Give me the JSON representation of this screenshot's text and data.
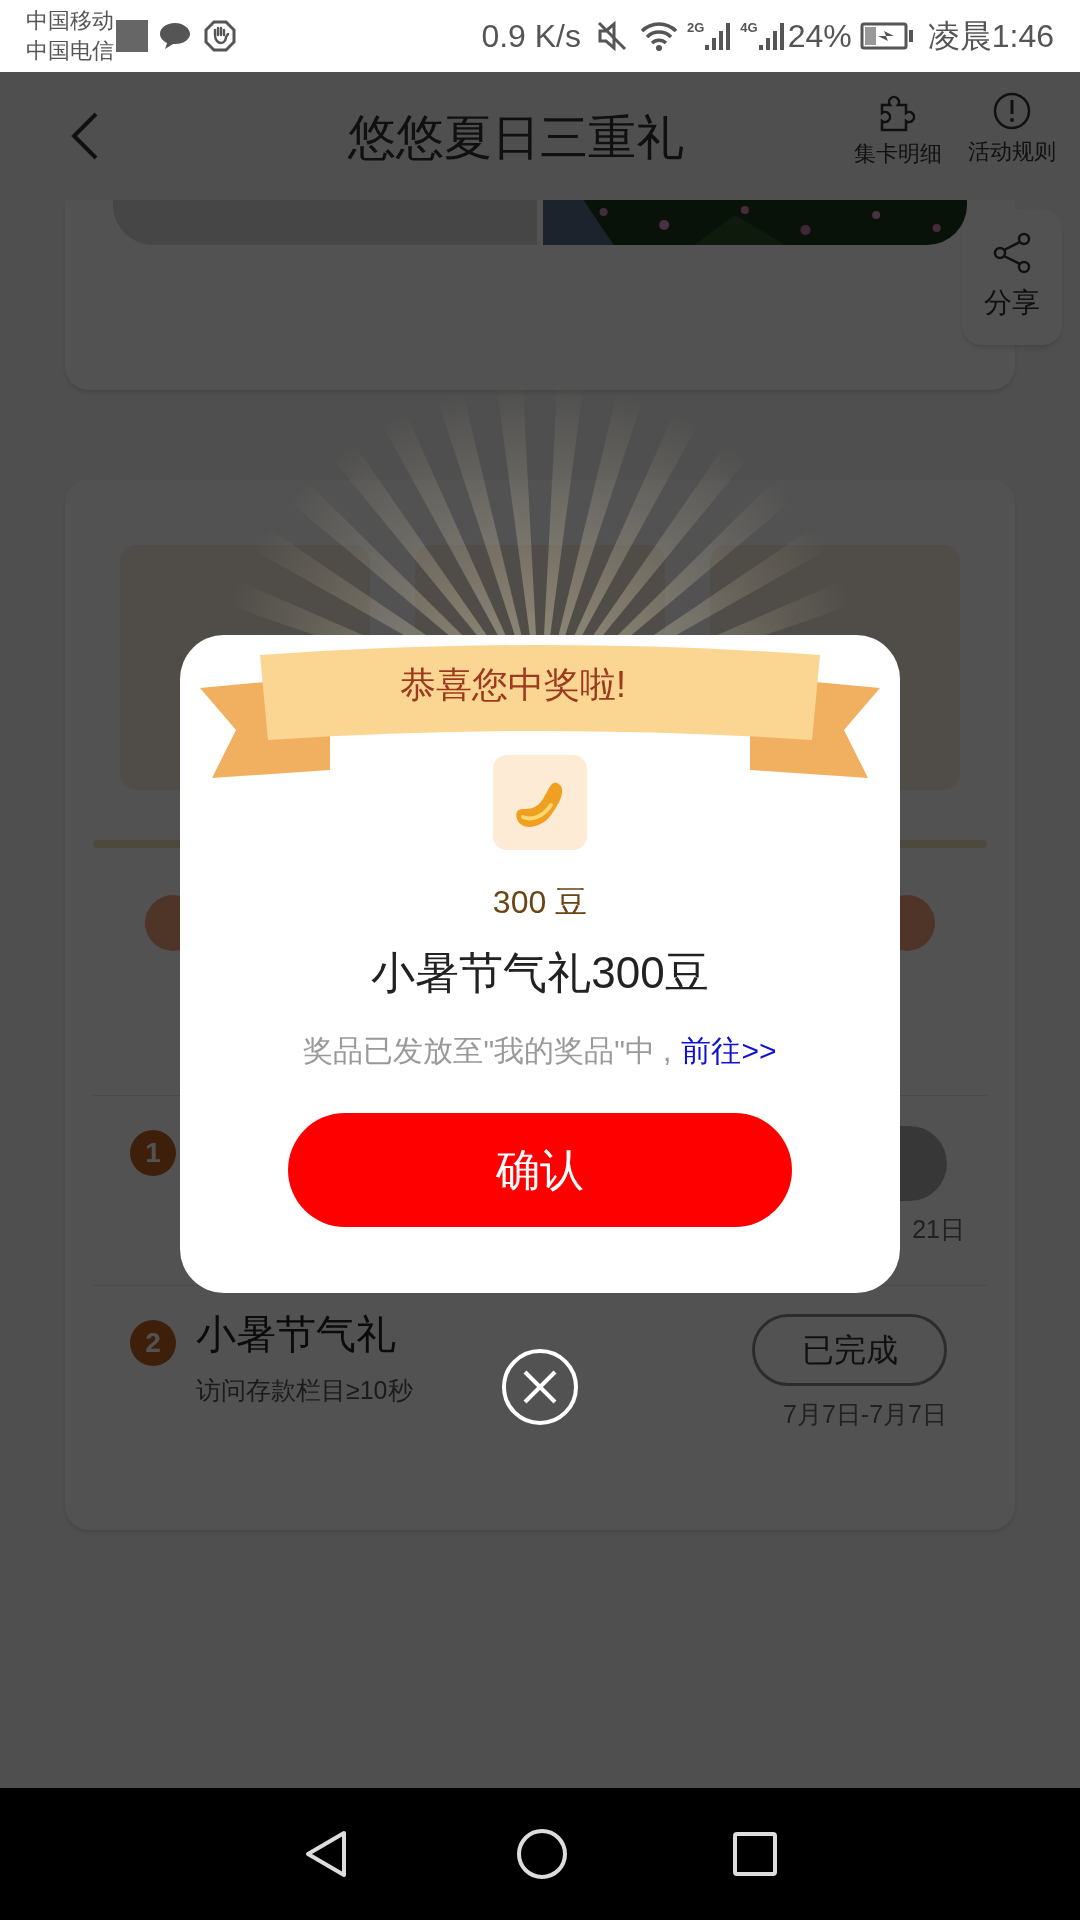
{
  "status_bar": {
    "carriers": [
      "中国移动",
      "中国电信"
    ],
    "net_speed": "0.9 K/s",
    "networks": [
      {
        "label": "2G"
      },
      {
        "label": "4G"
      }
    ],
    "battery": "24%",
    "time": "凌晨1:46"
  },
  "header": {
    "title": "悠悠夏日三重礼",
    "actions": [
      {
        "kind": "puzzle",
        "label": "集卡明细"
      },
      {
        "kind": "info",
        "label": "活动规则"
      }
    ],
    "share": "分享"
  },
  "tasks": [
    {
      "number": "1",
      "date": "21日"
    },
    {
      "number": "2",
      "title": "小暑节气礼",
      "description": "访问存款栏目≥10秒",
      "button": "已完成",
      "date": "7月7日-7月7日"
    }
  ],
  "modal": {
    "banner": "恭喜您中奖啦!",
    "prize_amount": "300 豆",
    "prize_name": "小暑节气礼300豆",
    "notice": "奖品已发放至\"我的奖品\"中 ,",
    "link": "前往>>",
    "confirm": "确认"
  }
}
